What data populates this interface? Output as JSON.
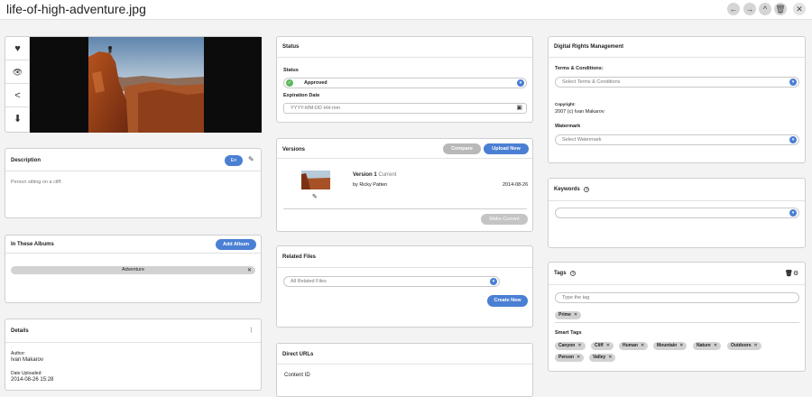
{
  "header": {
    "file_title": "life-of-high-adventure.jpg",
    "nav": {
      "prev": "←",
      "next": "→",
      "up": "^",
      "delete": "🗑",
      "close": "✕"
    }
  },
  "preview": {
    "actions": {
      "like": "♥",
      "view": "👁",
      "share": "<",
      "download": "⬇"
    }
  },
  "description": {
    "title": "Description",
    "lang": "En",
    "text": "Person sitting on a cliff."
  },
  "albums": {
    "title": "In These Albums",
    "add_label": "Add Album",
    "items": [
      "Adventure"
    ]
  },
  "details": {
    "title": "Details",
    "author_label": "Author:",
    "author": "Ivan Makarov",
    "uploaded_label": "Date Uploaded:",
    "uploaded": "2014-08-26 15:28"
  },
  "status": {
    "title": "Status",
    "status_label": "Status",
    "status_value": "Approved",
    "expiration_label": "Expiration Date",
    "expiration_placeholder": "YYYY-MM-DD HH:mm"
  },
  "versions": {
    "title": "Versions",
    "compare_label": "Compare",
    "upload_label": "Upload New",
    "version_name": "Version 1",
    "version_current": "Current",
    "by": "by Ricky Patten",
    "date": "2014-08-26",
    "make_current_label": "Make Current"
  },
  "related": {
    "title": "Related Files",
    "select_placeholder": "All Related Files",
    "create_label": "Create New"
  },
  "direct_urls": {
    "title": "Direct URLs",
    "content_id_label": "Content ID"
  },
  "drm": {
    "title": "Digital Rights Management",
    "terms_label": "Terms & Conditions:",
    "terms_placeholder": "Select Terms & Conditions",
    "copyright_label": "Copyright:",
    "copyright_value": "2007 (c) Ivan Makarov",
    "watermark_label": "Watermark",
    "watermark_placeholder": "Select Watermark"
  },
  "keywords": {
    "title": "Keywords",
    "help": "?"
  },
  "tags": {
    "title": "Tags",
    "help": "?",
    "input_placeholder": "Type the tag",
    "items": [
      "Prime"
    ],
    "smart_title": "Smart Tags",
    "smart_items": [
      "Canyon",
      "Cliff",
      "Human",
      "Mountain",
      "Nature",
      "Outdoors",
      "Person",
      "Valley"
    ]
  },
  "colors": {
    "accent": "#4a7fd4",
    "approved": "#5cb85c"
  }
}
